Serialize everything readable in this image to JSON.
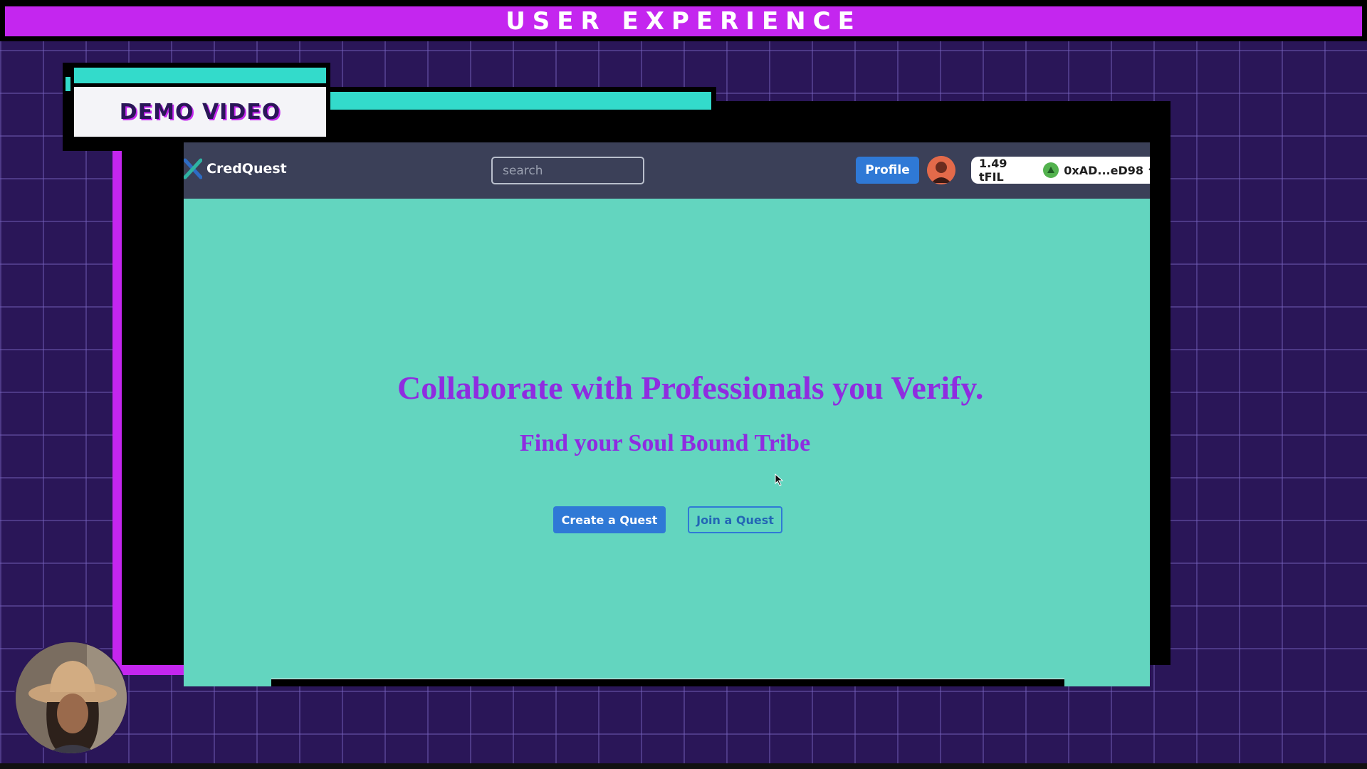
{
  "overlay": {
    "banner_title": "USER EXPERIENCE",
    "demo_label": "DEMO VIDEO",
    "colors": {
      "magenta": "#c426ef",
      "teal": "#33dbcb",
      "background": "#2a1658"
    }
  },
  "app": {
    "brand_name": "CredQuest",
    "brand_icon": "x-logo-icon",
    "search": {
      "placeholder": "search",
      "value": ""
    },
    "profile_label": "Profile",
    "avatar_icon": "user-avatar",
    "wallet": {
      "balance": "1.49 tFIL",
      "address": "0xAD...eD98"
    },
    "hero": {
      "title": "Collaborate with Professionals you Verify.",
      "subtitle": "Find your Soul Bound Tribe"
    },
    "buttons": {
      "create": "Create a Quest",
      "join": "Join a Quest"
    },
    "colors": {
      "hero_bg": "#63d5bf",
      "navbar_bg": "#3b4058",
      "primary": "#2f79d6",
      "accent_text": "#8f2ce0"
    }
  },
  "presenter": {
    "icon": "webcam-presenter"
  }
}
